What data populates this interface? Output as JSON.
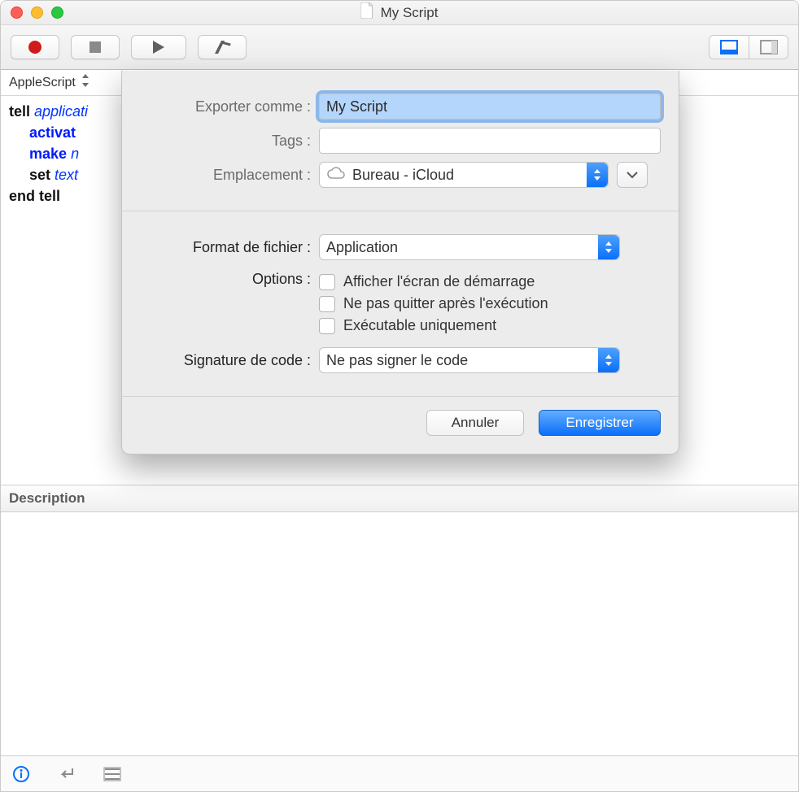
{
  "window": {
    "title": "My Script"
  },
  "languageSelector": "AppleScript",
  "code": {
    "l1a": "tell ",
    "l1b": "applicati",
    "l2": "activat",
    "l3a": "make ",
    "l3b": "n",
    "l4a": "set ",
    "l4b": "text",
    "l5": "end tell"
  },
  "desc": {
    "header": "Description"
  },
  "sheet": {
    "exportAsLabel": "Exporter comme :",
    "exportAsValue": "My Script",
    "tagsLabel": "Tags :",
    "tagsValue": "",
    "locationLabel": "Emplacement :",
    "locationValue": "Bureau - iCloud",
    "fileFormatLabel": "Format de fichier :",
    "fileFormatValue": "Application",
    "optionsLabel": "Options :",
    "opt1": "Afficher l'écran de démarrage",
    "opt2": "Ne pas quitter après l'exécution",
    "opt3": "Exécutable uniquement",
    "codeSignLabel": "Signature de code :",
    "codeSignValue": "Ne pas signer le code",
    "cancel": "Annuler",
    "save": "Enregistrer"
  }
}
